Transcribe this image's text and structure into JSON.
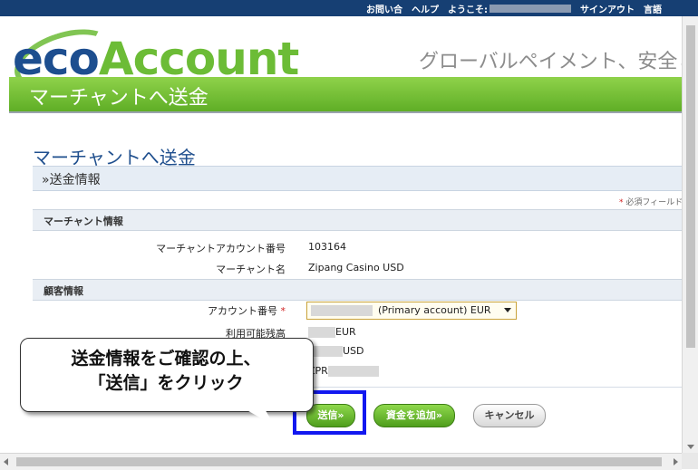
{
  "topbar": {
    "contact": "お問い合",
    "help": "ヘルプ",
    "welcome": "ようこそ:",
    "signout": "サインアウト",
    "language": "言語"
  },
  "logo": {
    "eco": "eco",
    "account": "Account"
  },
  "tagline": "グローバルペイメント、安全と簡",
  "header_band": "マーチャントへ送金",
  "page_title": "マーチャントへ送金",
  "section": "»送金情報",
  "required_note": {
    "star": "*",
    "text": " 必須フィールド"
  },
  "merchant_section": {
    "title": "マーチャント情報",
    "rows": [
      {
        "label": "マーチャントアカウント番号",
        "value": "103164"
      },
      {
        "label": "マーチャント名",
        "value": "Zipang Casino USD"
      }
    ]
  },
  "customer_section": {
    "title": "顧客情報",
    "account_label": "アカウント番号",
    "required_star": "*",
    "account_select": "(Primary account) EUR",
    "balance_label": "利用可能残高",
    "balance_eur": "EUR",
    "balance_usd": "USD",
    "reference_prefix": "ZPR"
  },
  "buttons": {
    "send": "送信»",
    "add_funds": "資金を追加»",
    "cancel": "キャンセル"
  },
  "callout": {
    "line1": "送金情報をご確認の上、",
    "line2": "「送信」をクリック"
  },
  "colors": {
    "topbar": "#163f73",
    "brand_blue": "#1d4e8f",
    "brand_green": "#6cbc36",
    "highlight": "#1218f0"
  }
}
